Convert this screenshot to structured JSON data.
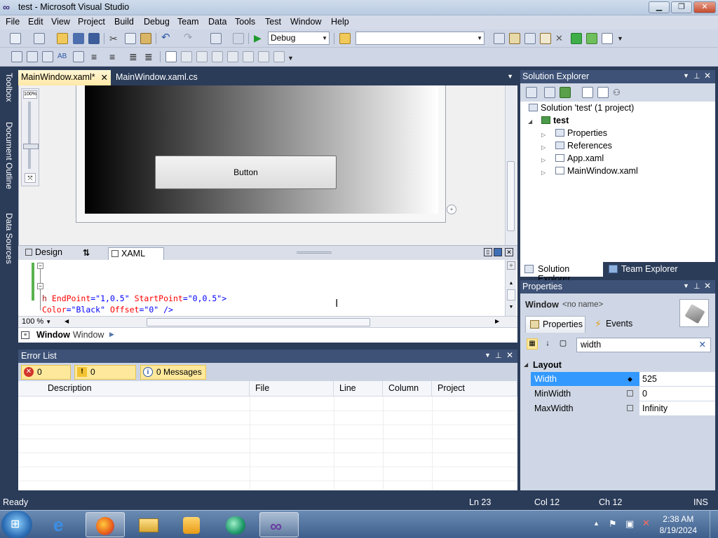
{
  "window": {
    "title": "test - Microsoft Visual Studio",
    "min": "0",
    "max": "1",
    "close": "r"
  },
  "menu": [
    "File",
    "Edit",
    "View",
    "Project",
    "Build",
    "Debug",
    "Team",
    "Data",
    "Tools",
    "Test",
    "Window",
    "Help"
  ],
  "toolbar": {
    "config_value": "Debug",
    "platform_value": ""
  },
  "left_dock": [
    "Toolbox",
    "Document Outline",
    "Data Sources"
  ],
  "doc_tabs": {
    "active": "MainWindow.xaml*",
    "inactive": "MainWindow.xaml.cs"
  },
  "designer": {
    "zoom_label": "100%",
    "button_text": "Button"
  },
  "split_tabs": {
    "design": "Design",
    "swap": "⇅",
    "xaml": "XAML"
  },
  "code": {
    "line1_a": "h ",
    "line1_b": "EndPoint",
    "line1_c": "=\"1,0.5\" ",
    "line1_d": "StartPoint",
    "line1_e": "=\"0,0.5\">",
    "line2_a": "Color",
    "line2_b": "=\"Black\" ",
    "line2_c": "Offset",
    "line2_d": "=\"0\" />"
  },
  "code_footer": {
    "zoom": "100 %"
  },
  "breadcrumbs": {
    "element": "Window",
    "type": "Window"
  },
  "error_list": {
    "title": "Error List",
    "filters": {
      "errors": "0 Errors",
      "warnings": "0 Warnings",
      "messages": "0 Messages"
    },
    "columns": [
      "Description",
      "File",
      "Line",
      "Column",
      "Project"
    ]
  },
  "solution_explorer": {
    "title": "Solution Explorer",
    "solution": "Solution 'test' (1 project)",
    "project": "test",
    "items": [
      "Properties",
      "References",
      "App.xaml",
      "MainWindow.xaml"
    ],
    "tabs": {
      "active": "Solution Explorer",
      "other": "Team Explorer"
    }
  },
  "properties": {
    "title": "Properties",
    "object_type": "Window",
    "object_name": "<no name>",
    "tabs": {
      "properties": "Properties",
      "events": "Events"
    },
    "search": "width",
    "category": "Layout",
    "rows": [
      {
        "name": "Width",
        "value": "525"
      },
      {
        "name": "MinWidth",
        "value": "0"
      },
      {
        "name": "MaxWidth",
        "value": "Infinity"
      }
    ]
  },
  "status": {
    "text": "Ready",
    "ln": "Ln 23",
    "col": "Col 12",
    "ch": "Ch 12",
    "mode": "INS"
  },
  "clock": {
    "time": "2:38 AM",
    "date": "8/19/2024"
  },
  "colors": {
    "accent": "#3e5277",
    "doc_tab_active": "#ffe8a6",
    "selection": "#3399ff"
  }
}
